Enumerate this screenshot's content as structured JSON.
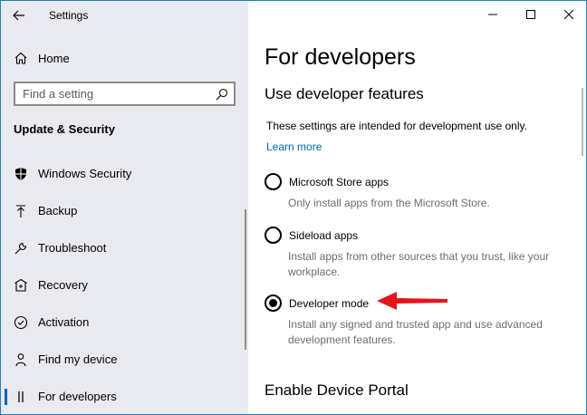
{
  "window": {
    "title": "Settings",
    "controls": [
      "minimize",
      "maximize",
      "close"
    ]
  },
  "sidebar": {
    "home_label": "Home",
    "search_placeholder": "Find a setting",
    "section_title": "Update & Security",
    "items": [
      {
        "label": "Windows Security",
        "icon": "shield-icon"
      },
      {
        "label": "Backup",
        "icon": "backup-arrow-icon"
      },
      {
        "label": "Troubleshoot",
        "icon": "wrench-icon"
      },
      {
        "label": "Recovery",
        "icon": "recovery-icon"
      },
      {
        "label": "Activation",
        "icon": "check-circle-icon"
      },
      {
        "label": "Find my device",
        "icon": "person-location-icon"
      },
      {
        "label": "For developers",
        "icon": "developer-icon",
        "active": true
      }
    ]
  },
  "main": {
    "page_title": "For developers",
    "section_title": "Use developer features",
    "description": "These settings are intended for development use only.",
    "learn_more": "Learn more",
    "options": [
      {
        "label": "Microsoft Store apps",
        "description": "Only install apps from the Microsoft Store.",
        "selected": false
      },
      {
        "label": "Sideload apps",
        "description": "Install apps from other sources that you trust, like your workplace.",
        "selected": false
      },
      {
        "label": "Developer mode",
        "description": "Install any signed and trusted app and use advanced development features.",
        "selected": true
      }
    ],
    "next_section_title": "Enable Device Portal"
  },
  "colors": {
    "sidebar_bg": "#e9e9f0",
    "accent": "#0067b8",
    "arrow": "#e3151a"
  }
}
